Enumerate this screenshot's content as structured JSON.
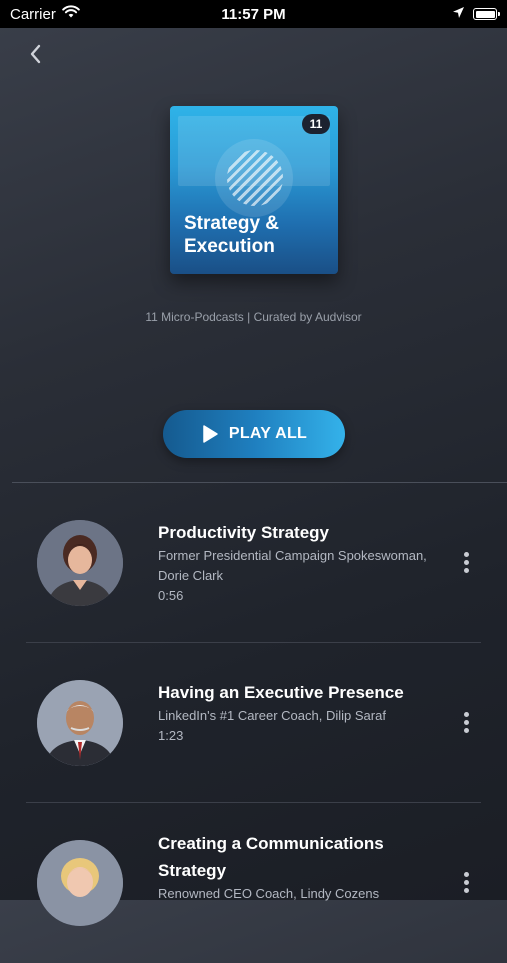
{
  "status_bar": {
    "carrier": "Carrier",
    "time": "11:57 PM"
  },
  "nav": {
    "back_icon": "chevron-left-icon"
  },
  "playlist": {
    "cover_title": "Strategy & Execution",
    "badge_count": "11",
    "subtitle": "11 Micro-Podcasts | Curated by Audvisor",
    "play_all_label": "PLAY ALL"
  },
  "items": [
    {
      "title": "Productivity Strategy",
      "description": "Former Presidential Campaign Spokeswoman, Dorie Clark",
      "duration": "0:56"
    },
    {
      "title": "Having an Executive Presence",
      "description": "LinkedIn's #1 Career Coach,  Dilip Saraf",
      "duration": "1:23"
    },
    {
      "title": "Creating a Communications Strategy",
      "description": "Renowned CEO Coach,  Lindy Cozens",
      "duration": ""
    }
  ],
  "colors": {
    "accent": "#2fb3e8",
    "background": "#23272f"
  }
}
